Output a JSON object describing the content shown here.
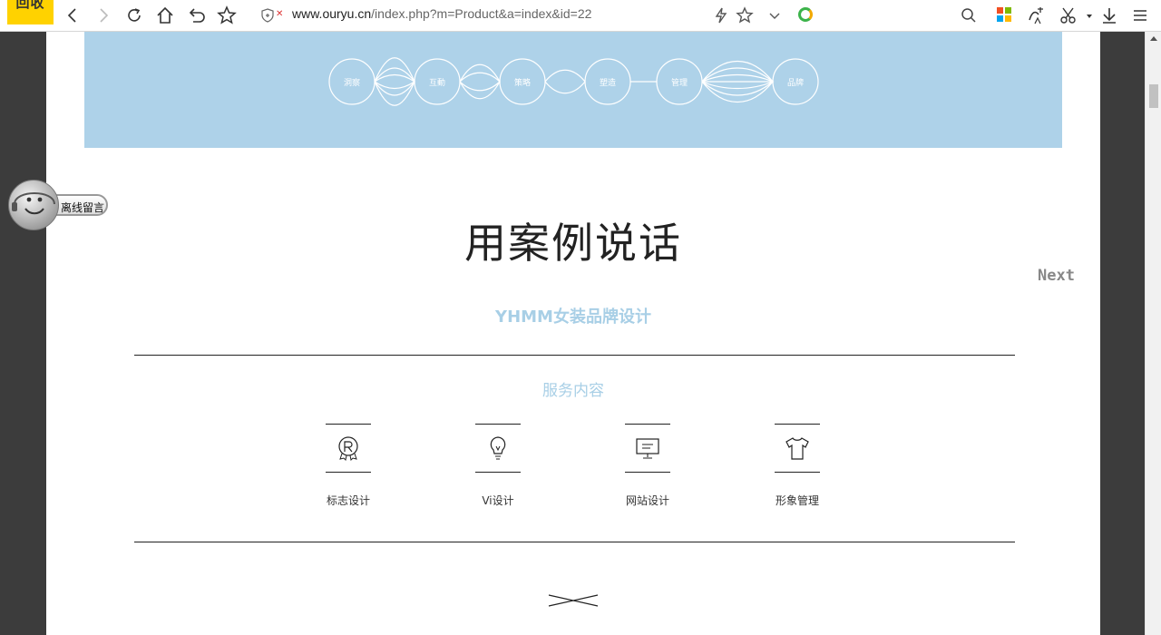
{
  "browser": {
    "back_return_label": "回收",
    "url_host": "www.ouryu.cn",
    "url_path": "/index.php?m=Product&a=index&id=22"
  },
  "banner": {
    "steps": [
      "洞察",
      "互動",
      "策略",
      "塑造",
      "管理",
      "品牌"
    ]
  },
  "page": {
    "headline": "用案例说话",
    "next_label": "Next",
    "project_name": "YHMM女装品牌设计",
    "services_title": "服务内容",
    "services": [
      {
        "label": "标志设计",
        "icon": "registered-badge-icon"
      },
      {
        "label": "Vi设计",
        "icon": "lightbulb-icon"
      },
      {
        "label": "网站设计",
        "icon": "monitor-icon"
      },
      {
        "label": "形象管理",
        "icon": "tshirt-icon"
      }
    ]
  },
  "chat_widget": {
    "label": "离线留言"
  }
}
